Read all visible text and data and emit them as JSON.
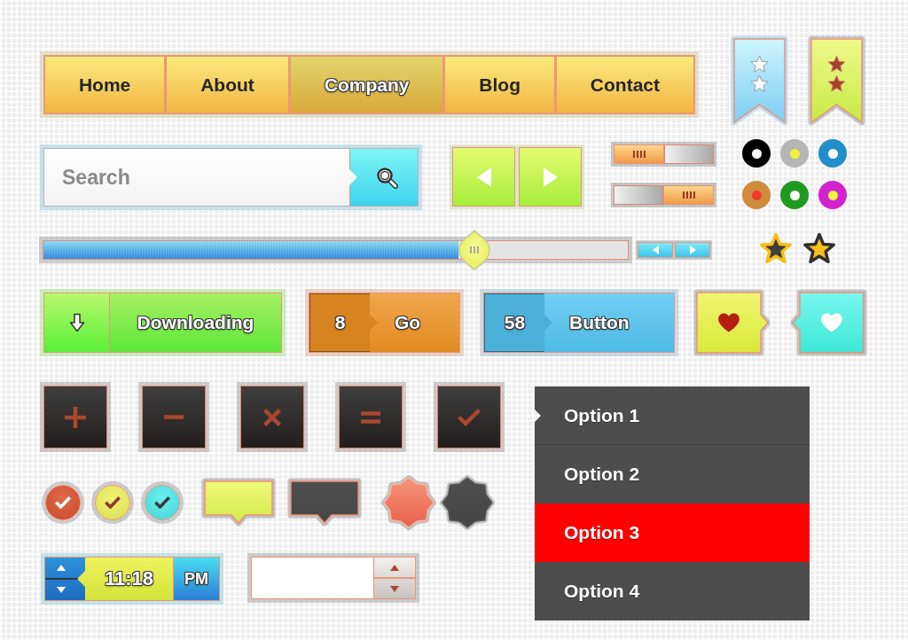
{
  "nav": [
    {
      "label": "Home",
      "selected": false
    },
    {
      "label": "About",
      "selected": false
    },
    {
      "label": "Company",
      "selected": true
    },
    {
      "label": "Blog",
      "selected": false
    },
    {
      "label": "Contact",
      "selected": false
    }
  ],
  "search": {
    "placeholder": "Search"
  },
  "toggles": [
    {
      "on": false
    },
    {
      "on": true
    }
  ],
  "dots": [
    {
      "color": "#000000",
      "center": {
        "color": "#ffffff"
      }
    },
    {
      "color": "#b5b5b5",
      "center": {
        "color": "#f2f23a"
      }
    },
    {
      "color": "#1f8ec9",
      "center": {
        "color": "#ffffff"
      }
    },
    {
      "color": "#d08a3c",
      "center": {
        "color": "#f03a2a"
      }
    },
    {
      "color": "#1f9a20",
      "center": {
        "color": "#ffffff"
      }
    },
    {
      "color": "#d222d2",
      "center": {
        "color": "#f2f23a"
      }
    }
  ],
  "slider": {
    "level": 0.71
  },
  "download_button": {
    "label": "Downloading"
  },
  "count_buttons": [
    {
      "count": "8",
      "label": "Go",
      "color": "#ee9224"
    },
    {
      "count": "58",
      "label": "Button",
      "color": "#52c4f0"
    }
  ],
  "icon_buttons": [
    {
      "kind": "plus"
    },
    {
      "kind": "minus"
    },
    {
      "kind": "close"
    },
    {
      "kind": "equals"
    },
    {
      "kind": "check"
    }
  ],
  "check_buttons": [
    {
      "checked": true,
      "color": "#d9502c",
      "tick": {
        "color": "#ffffff"
      }
    },
    {
      "checked": true,
      "color": "#eef05a",
      "tick": {
        "color": "#8a3a28"
      }
    },
    {
      "checked": true,
      "color": "#4eeaea",
      "tick": {
        "color": "#3a3a3a"
      }
    }
  ],
  "time_picker": {
    "time": "11:18",
    "period": "PM"
  },
  "menu": {
    "items": [
      {
        "label": "Option 1",
        "selected": false
      },
      {
        "label": "Option 2",
        "selected": false
      },
      {
        "label": "Option 3",
        "selected": true
      },
      {
        "label": "Option 4",
        "selected": false
      }
    ]
  }
}
